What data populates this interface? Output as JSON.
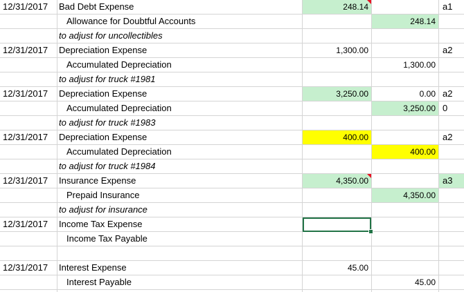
{
  "colors": {
    "green_fill": "#c6efce",
    "yellow_fill": "#ffff00",
    "comment_flag": "#e81123",
    "selection": "#217346"
  },
  "rows": [
    {
      "date": "12/31/2017",
      "account": "Bad Debt Expense",
      "debit": "248.14",
      "credit": "",
      "ref": "a1"
    },
    {
      "date": "",
      "account": "Allowance for Doubtful Accounts",
      "debit": "",
      "credit": "248.14",
      "ref": ""
    },
    {
      "date": "",
      "account": "to adjust for uncollectibles",
      "debit": "",
      "credit": "",
      "ref": ""
    },
    {
      "date": "12/31/2017",
      "account": "Depreciation Expense",
      "debit": "1,300.00",
      "credit": "",
      "ref": "a2"
    },
    {
      "date": "",
      "account": "Accumulated Depreciation",
      "debit": "",
      "credit": "1,300.00",
      "ref": ""
    },
    {
      "date": "",
      "account": "to adjust for truck #1981",
      "debit": "",
      "credit": "",
      "ref": ""
    },
    {
      "date": "12/31/2017",
      "account": "Depreciation Expense",
      "debit": "3,250.00",
      "credit": "0.00",
      "ref": "a2"
    },
    {
      "date": "",
      "account": "Accumulated Depreciation",
      "debit": "",
      "credit": "3,250.00",
      "ref": "0"
    },
    {
      "date": "",
      "account": "to adjust for truck #1983",
      "debit": "",
      "credit": "",
      "ref": ""
    },
    {
      "date": "12/31/2017",
      "account": "Depreciation Expense",
      "debit": "400.00",
      "credit": "",
      "ref": "a2"
    },
    {
      "date": "",
      "account": "Accumulated Depreciation",
      "debit": "",
      "credit": "400.00",
      "ref": ""
    },
    {
      "date": "",
      "account": "to adjust for truck #1984",
      "debit": "",
      "credit": "",
      "ref": ""
    },
    {
      "date": "12/31/2017",
      "account": "Insurance Expense",
      "debit": "4,350.00",
      "credit": "",
      "ref": "a3"
    },
    {
      "date": "",
      "account": "Prepaid Insurance",
      "debit": "",
      "credit": "4,350.00",
      "ref": ""
    },
    {
      "date": "",
      "account": "to adjust for insurance",
      "debit": "",
      "credit": "",
      "ref": ""
    },
    {
      "date": "12/31/2017",
      "account": "Income Tax Expense",
      "debit": "",
      "credit": "",
      "ref": ""
    },
    {
      "date": "",
      "account": "Income Tax Payable",
      "debit": "",
      "credit": "",
      "ref": ""
    },
    {
      "date": "",
      "account": "",
      "debit": "",
      "credit": "",
      "ref": ""
    },
    {
      "date": "12/31/2017",
      "account": "Interest Expense",
      "debit": "45.00",
      "credit": "",
      "ref": ""
    },
    {
      "date": "",
      "account": "Interest Payable",
      "debit": "",
      "credit": "45.00",
      "ref": ""
    }
  ]
}
